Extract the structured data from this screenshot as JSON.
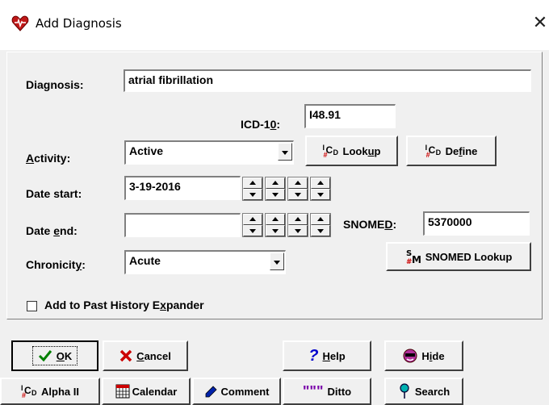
{
  "window": {
    "title": "Add Diagnosis",
    "close_glyph": "✕"
  },
  "diagnosis": {
    "label": "Diagnosis:",
    "value": "atrial fibrillation"
  },
  "icd10": {
    "label_pre": "ICD-1",
    "label_u": "0",
    "label_post": ":",
    "value": "I48.91"
  },
  "activity": {
    "label_u": "A",
    "label_rest": "ctivity:",
    "value": "Active"
  },
  "date_start": {
    "label": "Date start:",
    "value": "3-19-2016"
  },
  "date_end": {
    "label_pre": "Date ",
    "label_u": "e",
    "label_post": "nd:",
    "value": ""
  },
  "snomed": {
    "label_pre": "SNOME",
    "label_u": "D",
    "label_post": ":",
    "value": "5370000"
  },
  "chronicity": {
    "label_pre": "Chronicit",
    "label_u": "y",
    "label_post": ":",
    "value": "Acute"
  },
  "buttons": {
    "lookup": {
      "pre": "Look",
      "u": "u",
      "post": "p"
    },
    "define": {
      "pre": "De",
      "u": "f",
      "post": "ine"
    },
    "snomed_lookup": "SNOMED Lookup",
    "ok": {
      "u": "O",
      "post": "K"
    },
    "cancel": {
      "u": "C",
      "post": "ancel"
    },
    "help": {
      "u": "H",
      "post": "elp"
    },
    "hide": {
      "pre": "H",
      "u": "i",
      "post": "de"
    },
    "alpha": "Alpha II",
    "calendar": "Calendar",
    "comment": "Comment",
    "ditto": "Ditto",
    "search": "Search"
  },
  "past_history": {
    "pre": "Add to Past History E",
    "u": "x",
    "post": "pander",
    "checked": false
  },
  "colors": {
    "accent": "#0000cc",
    "cancel_red": "#cc0000",
    "ok_green": "#008000"
  }
}
